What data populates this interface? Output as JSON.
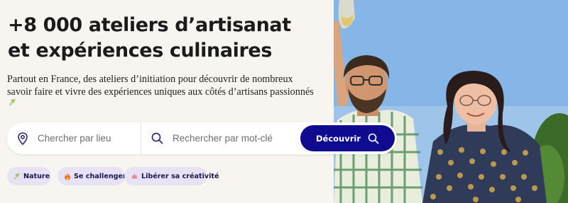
{
  "hero": {
    "title_line1": "+8 000 ateliers d’artisanat",
    "title_line2": "et expériences culinaires",
    "subtitle": "Partout en France, des ateliers d’initiation pour découvrir de nombreux savoir faire et vivre des expériences uniques aux côtés d’artisans passionnés"
  },
  "search": {
    "location_placeholder": "Chercher par lieu",
    "keyword_placeholder": "Rechercher par mot-clé",
    "submit_label": "Découvrir"
  },
  "chips": [
    {
      "label": "Nature",
      "icon": "herb-icon"
    },
    {
      "label": "Se challenger",
      "icon": "fire-icon"
    },
    {
      "label": "Libérer sa créativité",
      "icon": "shell-icon"
    }
  ],
  "colors": {
    "background": "#f8f4ef",
    "accent": "#0f0a8f",
    "chip_background": "#e7e2f5"
  }
}
